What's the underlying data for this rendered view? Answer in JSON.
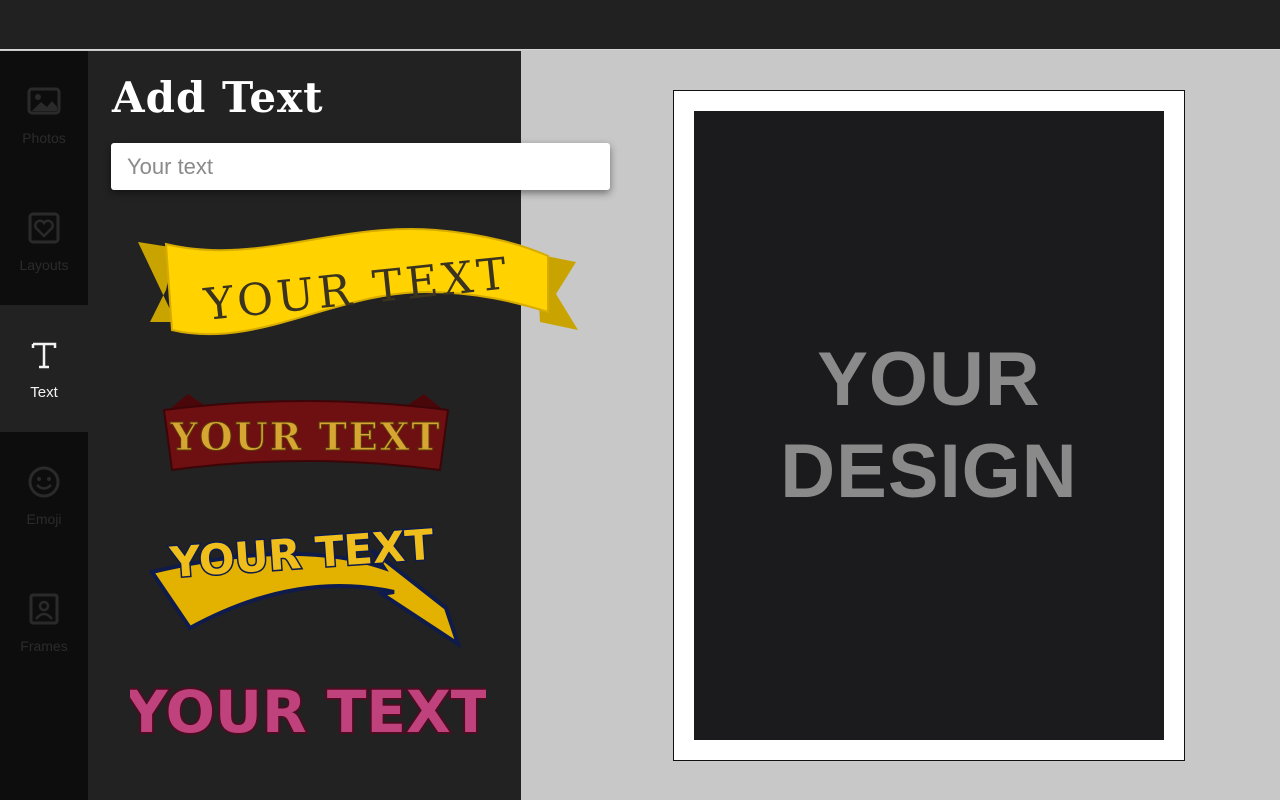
{
  "sidebar": {
    "items": [
      {
        "label": "Photos",
        "icon": "image-icon",
        "active": false
      },
      {
        "label": "Layouts",
        "icon": "heart-frame-icon",
        "active": false
      },
      {
        "label": "Text",
        "icon": "text-t-icon",
        "active": true
      },
      {
        "label": "Emoji",
        "icon": "smiley-icon",
        "active": false
      },
      {
        "label": "Frames",
        "icon": "portrait-frame-icon",
        "active": false
      }
    ]
  },
  "panel": {
    "title": "Add Text",
    "input_placeholder": "Your text",
    "input_value": "",
    "presets": [
      {
        "text": "YOUR TEXT",
        "style": "yellow-ribbon-banner"
      },
      {
        "text": "YOUR TEXT",
        "style": "red-banner-gold-letters"
      },
      {
        "text": "YOUR TEXT",
        "style": "yellow-arch-arrow"
      },
      {
        "text": "YOUR TEXT",
        "style": "pink-marquee-lights"
      }
    ]
  },
  "canvas": {
    "line1": "YOUR",
    "line2": "DESIGN"
  },
  "colors": {
    "topbar": "#212121",
    "rail": "#0d0d0d",
    "panel": "#222222",
    "workspace": "#c8c8c8",
    "canvas_inner": "#1b1b1d",
    "canvas_text": "#8a8a8a",
    "ribbon_yellow": "#ffd200",
    "banner_red": "#6e0f12",
    "marquee_pink": "#c0427c"
  }
}
